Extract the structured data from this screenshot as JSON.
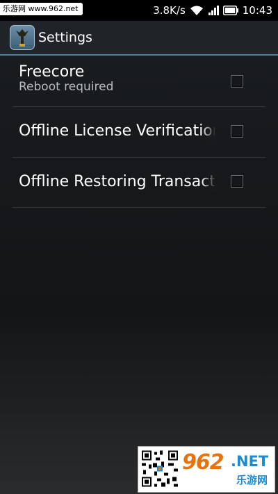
{
  "status_bar": {
    "watermark": "乐游网 www.962.net",
    "speed": "3.8K/s",
    "time": "10:43"
  },
  "action_bar": {
    "title": "Settings",
    "accent_color": "#4a83a9"
  },
  "preferences": [
    {
      "title": "Freecore",
      "summary": "Reboot required",
      "checked": false
    },
    {
      "title": "Offline License Verification",
      "checked": false
    },
    {
      "title": "Offline Restoring Transactions",
      "checked": false
    }
  ],
  "watermark": {
    "number": "962",
    "domain": ".NET",
    "cn_name": "乐游网",
    "brand_colors": [
      "#e8730c",
      "#1d8ad1"
    ]
  },
  "icons": [
    "app-icon",
    "wifi-icon",
    "signal-icon",
    "battery-icon",
    "qr-code-icon"
  ]
}
